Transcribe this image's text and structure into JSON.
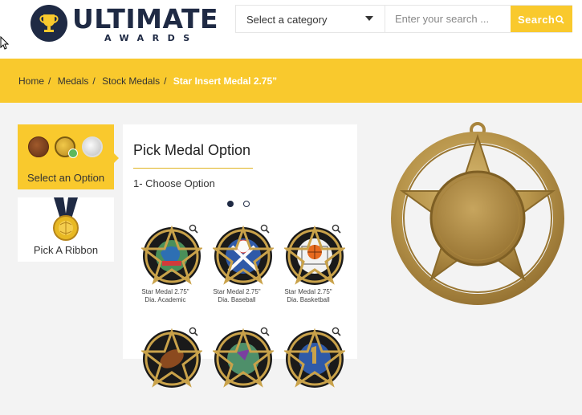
{
  "logo": {
    "word": "ULTIMATE",
    "sub": "AWARDS"
  },
  "search": {
    "category_label": "Select a category",
    "placeholder": "Enter your search ...",
    "button_label": "Search"
  },
  "breadcrumb": {
    "home": "Home",
    "medals": "Medals",
    "stock": "Stock Medals",
    "current": "Star Insert Medal 2.75”"
  },
  "options": {
    "select_label": "Select an Option",
    "ribbon_label": "Pick A Ribbon"
  },
  "panel": {
    "title": "Pick Medal Option",
    "step": "1- Choose Option"
  },
  "tiles": [
    {
      "line1": "Star Medal 2.75\"",
      "line2": "Dia. Academic",
      "icon": "academic-icon"
    },
    {
      "line1": "Star Medal 2.75\"",
      "line2": "Dia. Baseball",
      "icon": "baseball-icon"
    },
    {
      "line1": "Star Medal 2.75\"",
      "line2": "Dia. Basketball",
      "icon": "basketball-icon"
    }
  ],
  "colors": {
    "accent": "#f9c92d",
    "navy": "#1f2a44",
    "gold": "#c9a24a"
  }
}
